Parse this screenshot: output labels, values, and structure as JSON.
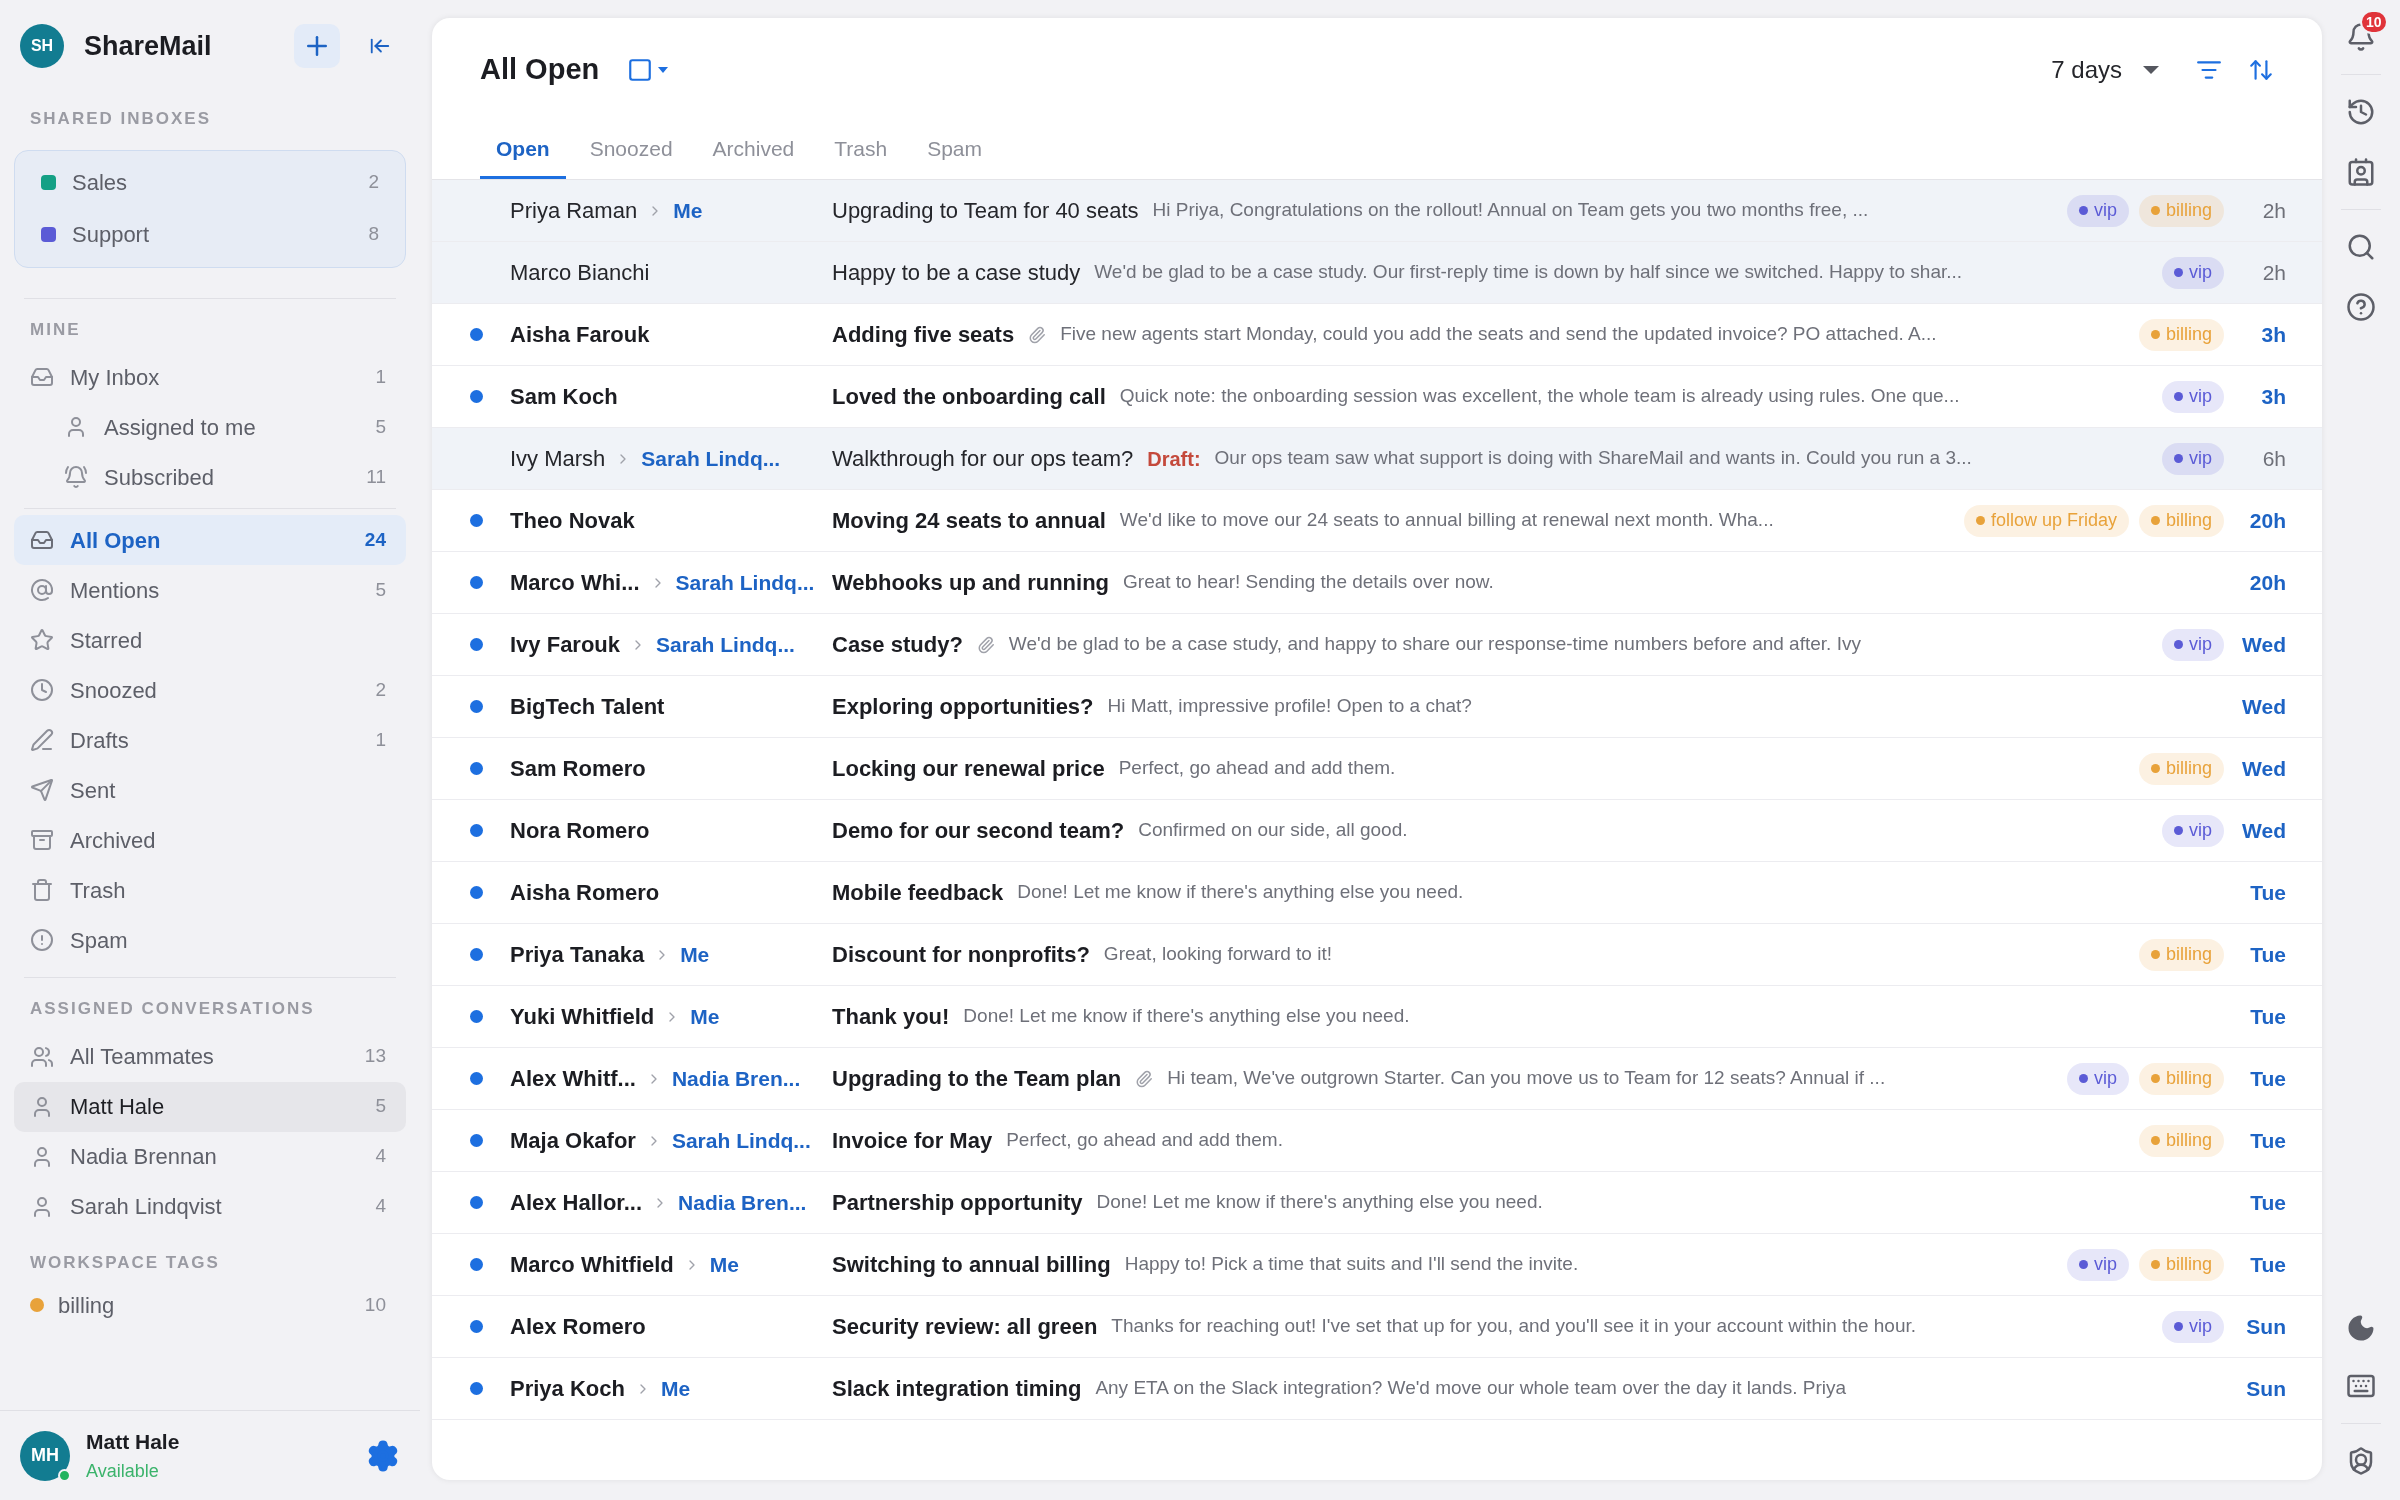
{
  "app": {
    "initials": "SH",
    "name": "ShareMail"
  },
  "shared_inboxes": {
    "heading": "SHARED INBOXES",
    "items": [
      {
        "label": "Sales",
        "count": "2",
        "color": "#14a085"
      },
      {
        "label": "Support",
        "count": "8",
        "color": "#5b5bd6"
      }
    ]
  },
  "mine": {
    "heading": "MINE",
    "items": [
      {
        "label": "My Inbox",
        "count": "1",
        "children": [
          {
            "label": "Assigned to me",
            "count": "5"
          },
          {
            "label": "Subscribed",
            "count": "11"
          }
        ]
      }
    ]
  },
  "folders": [
    {
      "label": "All Open",
      "count": "24",
      "selected": true
    },
    {
      "label": "Mentions",
      "count": "5",
      "selected": false
    },
    {
      "label": "Starred",
      "selected": false
    },
    {
      "label": "Snoozed",
      "count": "2",
      "selected": false
    },
    {
      "label": "Drafts",
      "count": "1",
      "selected": false
    },
    {
      "label": "Sent",
      "selected": false
    },
    {
      "label": "Archived",
      "selected": false
    },
    {
      "label": "Trash",
      "selected": false
    },
    {
      "label": "Spam",
      "selected": false
    }
  ],
  "assigned": {
    "heading": "ASSIGNED CONVERSATIONS",
    "items": [
      {
        "label": "All Teammates",
        "count": "13",
        "kind": "team",
        "selected": false
      },
      {
        "label": "Matt Hale",
        "count": "5",
        "kind": "person",
        "selected": true
      },
      {
        "label": "Nadia Brennan",
        "count": "4",
        "kind": "person",
        "selected": false
      },
      {
        "label": "Sarah Lindqvist",
        "count": "4",
        "kind": "person",
        "selected": false
      }
    ]
  },
  "workspace_tags": {
    "heading": "WORKSPACE TAGS",
    "items": [
      {
        "label": "billing",
        "count": "10",
        "color": "#e8a23a"
      }
    ]
  },
  "user": {
    "initials": "MH",
    "name": "Matt Hale",
    "status": "Available"
  },
  "main": {
    "title": "All Open",
    "range": "7 days",
    "tabs": [
      {
        "label": "Open",
        "selected": true
      },
      {
        "label": "Snoozed",
        "selected": false
      },
      {
        "label": "Archived",
        "selected": false
      },
      {
        "label": "Trash",
        "selected": false
      },
      {
        "label": "Spam",
        "selected": false
      }
    ],
    "conversations": [
      {
        "from": "Priya Raman",
        "assignee": "Me",
        "unread": false,
        "subject": "Upgrading to Team for 40 seats",
        "preview": "Hi Priya, Congratulations on the rollout! Annual on Team gets you two months free, ...",
        "tags": [
          {
            "label": "vip",
            "color": "#5b5bd6"
          },
          {
            "label": "billing",
            "color": "#e8a23a"
          }
        ],
        "time": "2h"
      },
      {
        "from": "Marco Bianchi",
        "unread": false,
        "subject": "Happy to be a case study",
        "preview": "We'd be glad to be a case study. Our first-reply time is down by half since we switched. Happy to shar...",
        "tags": [
          {
            "label": "vip",
            "color": "#5b5bd6"
          }
        ],
        "time": "2h"
      },
      {
        "from": "Aisha Farouk",
        "unread": true,
        "subject": "Adding five seats",
        "attachment": true,
        "preview": "Five new agents start Monday, could you add the seats and send the updated invoice? PO attached. A...",
        "tags": [
          {
            "label": "billing",
            "color": "#e8a23a"
          }
        ],
        "time": "3h"
      },
      {
        "from": "Sam Koch",
        "unread": true,
        "subject": "Loved the onboarding call",
        "preview": "Quick note: the onboarding session was excellent, the whole team is already using rules. One que...",
        "tags": [
          {
            "label": "vip",
            "color": "#5b5bd6"
          }
        ],
        "time": "3h"
      },
      {
        "from": "Ivy Marsh",
        "assignee": "Sarah Lindq...",
        "unread": false,
        "subject": "Walkthrough for our ops team?",
        "draft": "Draft:",
        "preview": "Our ops team saw what support is doing with ShareMail and wants in. Could you run a 3...",
        "tags": [
          {
            "label": "vip",
            "color": "#5b5bd6"
          }
        ],
        "time": "6h"
      },
      {
        "from": "Theo Novak",
        "unread": true,
        "subject": "Moving 24 seats to annual",
        "preview": "We'd like to move our 24 seats to annual billing at renewal next month. Wha...",
        "tags": [
          {
            "label": "follow up Friday",
            "color": "#e8a23a"
          },
          {
            "label": "billing",
            "color": "#e8a23a"
          }
        ],
        "time": "20h"
      },
      {
        "from": "Marco Whi...",
        "assignee": "Sarah Lindq...",
        "unread": true,
        "subject": "Webhooks up and running",
        "preview": "Great to hear! Sending the details over now.",
        "time": "20h"
      },
      {
        "from": "Ivy Farouk",
        "assignee": "Sarah Lindq...",
        "unread": true,
        "subject": "Case study?",
        "attachment": true,
        "preview": "We'd be glad to be a case study, and happy to share our response-time numbers before and after. Ivy",
        "tags": [
          {
            "label": "vip",
            "color": "#5b5bd6"
          }
        ],
        "time": "Wed"
      },
      {
        "from": "BigTech Talent",
        "unread": true,
        "subject": "Exploring opportunities?",
        "preview": "Hi Matt, impressive profile! Open to a chat?",
        "time": "Wed"
      },
      {
        "from": "Sam Romero",
        "unread": true,
        "subject": "Locking our renewal price",
        "preview": "Perfect, go ahead and add them.",
        "tags": [
          {
            "label": "billing",
            "color": "#e8a23a"
          }
        ],
        "time": "Wed"
      },
      {
        "from": "Nora Romero",
        "unread": true,
        "subject": "Demo for our second team?",
        "preview": "Confirmed on our side, all good.",
        "tags": [
          {
            "label": "vip",
            "color": "#5b5bd6"
          }
        ],
        "time": "Wed"
      },
      {
        "from": "Aisha Romero",
        "unread": true,
        "subject": "Mobile feedback",
        "preview": "Done! Let me know if there's anything else you need.",
        "time": "Tue"
      },
      {
        "from": "Priya Tanaka",
        "assignee": "Me",
        "unread": true,
        "subject": "Discount for nonprofits?",
        "preview": "Great, looking forward to it!",
        "tags": [
          {
            "label": "billing",
            "color": "#e8a23a"
          }
        ],
        "time": "Tue"
      },
      {
        "from": "Yuki Whitfield",
        "assignee": "Me",
        "unread": true,
        "subject": "Thank you!",
        "preview": "Done! Let me know if there's anything else you need.",
        "time": "Tue"
      },
      {
        "from": "Alex Whitf...",
        "assignee": "Nadia Bren...",
        "unread": true,
        "subject": "Upgrading to the Team plan",
        "attachment": true,
        "preview": "Hi team, We've outgrown Starter. Can you move us to Team for 12 seats? Annual if ...",
        "tags": [
          {
            "label": "vip",
            "color": "#5b5bd6"
          },
          {
            "label": "billing",
            "color": "#e8a23a"
          }
        ],
        "time": "Tue"
      },
      {
        "from": "Maja Okafor",
        "assignee": "Sarah Lindq...",
        "unread": true,
        "subject": "Invoice for May",
        "preview": "Perfect, go ahead and add them.",
        "tags": [
          {
            "label": "billing",
            "color": "#e8a23a"
          }
        ],
        "time": "Tue"
      },
      {
        "from": "Alex Hallor...",
        "assignee": "Nadia Bren...",
        "unread": true,
        "subject": "Partnership opportunity",
        "preview": "Done! Let me know if there's anything else you need.",
        "time": "Tue"
      },
      {
        "from": "Marco Whitfield",
        "assignee": "Me",
        "unread": true,
        "subject": "Switching to annual billing",
        "preview": "Happy to! Pick a time that suits and I'll send the invite.",
        "tags": [
          {
            "label": "vip",
            "color": "#5b5bd6"
          },
          {
            "label": "billing",
            "color": "#e8a23a"
          }
        ],
        "time": "Tue"
      },
      {
        "from": "Alex Romero",
        "unread": true,
        "subject": "Security review: all green",
        "preview": "Thanks for reaching out! I've set that up for you, and you'll see it in your account within the hour.",
        "tags": [
          {
            "label": "vip",
            "color": "#5b5bd6"
          }
        ],
        "time": "Sun"
      },
      {
        "from": "Priya Koch",
        "assignee": "Me",
        "unread": true,
        "subject": "Slack integration timing",
        "preview": "Any ETA on the Slack integration? We'd move our whole team over the day it lands. Priya",
        "time": "Sun"
      }
    ]
  },
  "notifications": {
    "count": "10"
  }
}
